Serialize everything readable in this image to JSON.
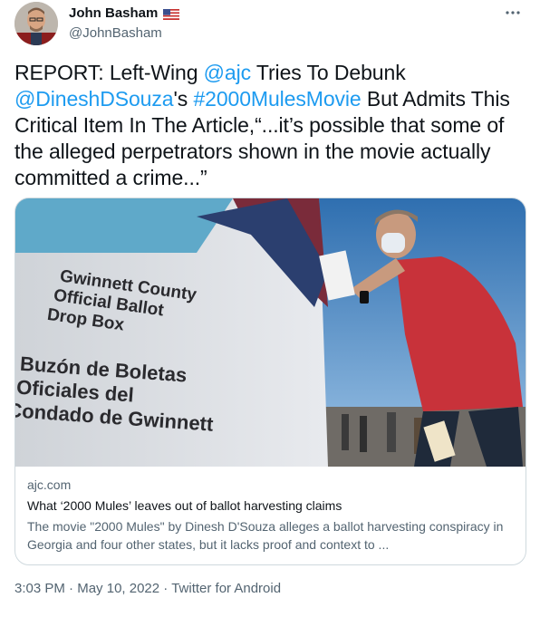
{
  "author": {
    "display_name": "John Basham",
    "handle": "@JohnBasham",
    "flag_icon": "us-flag-icon"
  },
  "tweet": {
    "segments": [
      {
        "text": "REPORT: Left-Wing ",
        "type": "text"
      },
      {
        "text": "@ajc",
        "type": "link"
      },
      {
        "text": " Tries To Debunk ",
        "type": "text"
      },
      {
        "text": "@DineshDSouza",
        "type": "link"
      },
      {
        "text": "'s ",
        "type": "text"
      },
      {
        "text": "#2000MulesMovie",
        "type": "link"
      },
      {
        "text": " But Admits This Critical Item In The Article,“...it’s possible that some of the alleged perpetrators shown in the movie actually committed a crime...”",
        "type": "text"
      }
    ]
  },
  "card": {
    "image_text": {
      "line1": "Gwinnett County",
      "line2": "Official Ballot",
      "line3": "Drop Box",
      "line4": "Buzón de Boletas",
      "line5": "Oficiales del",
      "line6": "Condado de Gwinnett"
    },
    "domain": "ajc.com",
    "title": "What ‘2000 Mules’ leaves out of ballot harvesting claims",
    "description": "The movie \"2000 Mules\" by Dinesh D'Souza alleges a ballot harvesting conspiracy in Georgia and four other states, but it lacks proof and context to ..."
  },
  "footer": {
    "time": "3:03 PM",
    "separator": " · ",
    "date": "May 10, 2022",
    "source": "Twitter for Android"
  },
  "colors": {
    "link": "#1d9bf0",
    "secondary_text": "#536471",
    "border": "#cfd9de"
  }
}
